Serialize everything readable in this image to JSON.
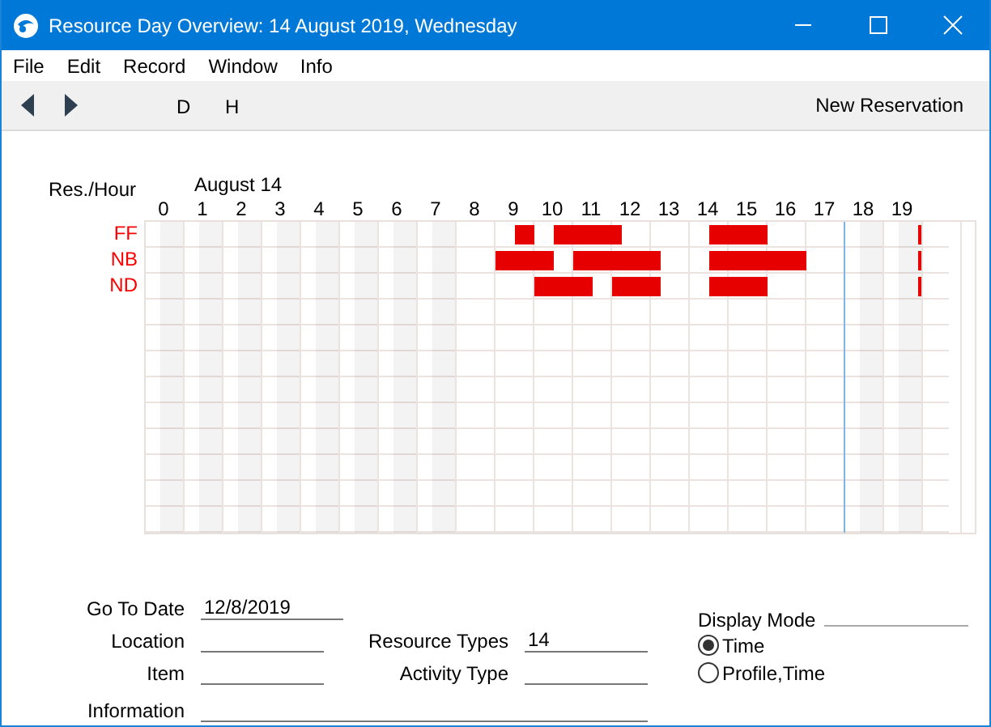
{
  "window": {
    "title": "Resource Day Overview: 14 August 2019, Wednesday"
  },
  "menu": [
    "File",
    "Edit",
    "Record",
    "Window",
    "Info"
  ],
  "toolbar": {
    "view_buttons": [
      "D",
      "H"
    ],
    "action": "New Reservation"
  },
  "schedule": {
    "corner_label": "Res./Hour",
    "date": "August 14",
    "hours": [
      {
        "label": "0",
        "off": true,
        "marker": false
      },
      {
        "label": "1",
        "off": true,
        "marker": false
      },
      {
        "label": "2",
        "off": true,
        "marker": false
      },
      {
        "label": "3",
        "off": true,
        "marker": false
      },
      {
        "label": "4",
        "off": true,
        "marker": false
      },
      {
        "label": "5",
        "off": true,
        "marker": false
      },
      {
        "label": "6",
        "off": true,
        "marker": false
      },
      {
        "label": "7",
        "off": true,
        "marker": false
      },
      {
        "label": "8",
        "off": false,
        "marker": false
      },
      {
        "label": "9",
        "off": false,
        "marker": false
      },
      {
        "label": "10",
        "off": false,
        "marker": false
      },
      {
        "label": "11",
        "off": false,
        "marker": false
      },
      {
        "label": "12",
        "off": false,
        "marker": false
      },
      {
        "label": "13",
        "off": false,
        "marker": false
      },
      {
        "label": "14",
        "off": false,
        "marker": false
      },
      {
        "label": "15",
        "off": false,
        "marker": false
      },
      {
        "label": "16",
        "off": false,
        "marker": false
      },
      {
        "label": "17",
        "off": false,
        "marker": false
      },
      {
        "label": "18",
        "off": true,
        "marker": true
      },
      {
        "label": "19",
        "off": true,
        "marker": false
      }
    ],
    "resources": [
      {
        "name": "FF",
        "continues": true,
        "quarters": [
          [
            false,
            false,
            false,
            false
          ],
          [
            false,
            false,
            false,
            false
          ],
          [
            false,
            false,
            false,
            false
          ],
          [
            false,
            false,
            false,
            false
          ],
          [
            false,
            false,
            false,
            false
          ],
          [
            false,
            false,
            false,
            false
          ],
          [
            false,
            false,
            false,
            false
          ],
          [
            false,
            false,
            false,
            false
          ],
          [
            false,
            false,
            false,
            false
          ],
          [
            false,
            false,
            true,
            true
          ],
          [
            false,
            false,
            true,
            true
          ],
          [
            true,
            true,
            true,
            true
          ],
          [
            true,
            false,
            false,
            false
          ],
          [
            false,
            false,
            false,
            false
          ],
          [
            false,
            false,
            true,
            true
          ],
          [
            true,
            true,
            true,
            true
          ],
          [
            false,
            false,
            false,
            false
          ],
          [
            false,
            false,
            false,
            false
          ],
          [
            false,
            false,
            false,
            false
          ],
          [
            false,
            false,
            false,
            false
          ]
        ]
      },
      {
        "name": "NB",
        "continues": true,
        "quarters": [
          [
            false,
            false,
            false,
            false
          ],
          [
            false,
            false,
            false,
            false
          ],
          [
            false,
            false,
            false,
            false
          ],
          [
            false,
            false,
            false,
            false
          ],
          [
            false,
            false,
            false,
            false
          ],
          [
            false,
            false,
            false,
            false
          ],
          [
            false,
            false,
            false,
            false
          ],
          [
            false,
            false,
            false,
            false
          ],
          [
            false,
            false,
            false,
            false
          ],
          [
            true,
            true,
            true,
            true
          ],
          [
            true,
            true,
            false,
            false
          ],
          [
            true,
            true,
            true,
            true
          ],
          [
            true,
            true,
            true,
            true
          ],
          [
            true,
            false,
            false,
            false
          ],
          [
            false,
            false,
            true,
            true
          ],
          [
            true,
            true,
            true,
            true
          ],
          [
            true,
            true,
            true,
            true
          ],
          [
            false,
            false,
            false,
            false
          ],
          [
            false,
            false,
            false,
            false
          ],
          [
            false,
            false,
            false,
            false
          ]
        ]
      },
      {
        "name": "ND",
        "continues": true,
        "quarters": [
          [
            false,
            false,
            false,
            false
          ],
          [
            false,
            false,
            false,
            false
          ],
          [
            false,
            false,
            false,
            false
          ],
          [
            false,
            false,
            false,
            false
          ],
          [
            false,
            false,
            false,
            false
          ],
          [
            false,
            false,
            false,
            false
          ],
          [
            false,
            false,
            false,
            false
          ],
          [
            false,
            false,
            false,
            false
          ],
          [
            false,
            false,
            false,
            false
          ],
          [
            false,
            false,
            false,
            false
          ],
          [
            true,
            true,
            true,
            true
          ],
          [
            true,
            true,
            false,
            false
          ],
          [
            true,
            true,
            true,
            true
          ],
          [
            true,
            false,
            false,
            false
          ],
          [
            false,
            false,
            true,
            true
          ],
          [
            true,
            true,
            true,
            true
          ],
          [
            false,
            false,
            false,
            false
          ],
          [
            false,
            false,
            false,
            false
          ],
          [
            false,
            false,
            false,
            false
          ],
          [
            false,
            false,
            false,
            false
          ]
        ]
      }
    ]
  },
  "form": {
    "go_to_date": {
      "label": "Go To Date",
      "value": "12/8/2019"
    },
    "location": {
      "label": "Location"
    },
    "resource_types": {
      "label": "Resource Types",
      "value": "14"
    },
    "item": {
      "label": "Item"
    },
    "activity_type": {
      "label": "Activity Type"
    },
    "information": {
      "label": "Information"
    },
    "display_mode": {
      "label": "Display Mode",
      "options": [
        {
          "label": "Time",
          "selected": true
        },
        {
          "label": "Profile,Time",
          "selected": false
        }
      ]
    }
  }
}
